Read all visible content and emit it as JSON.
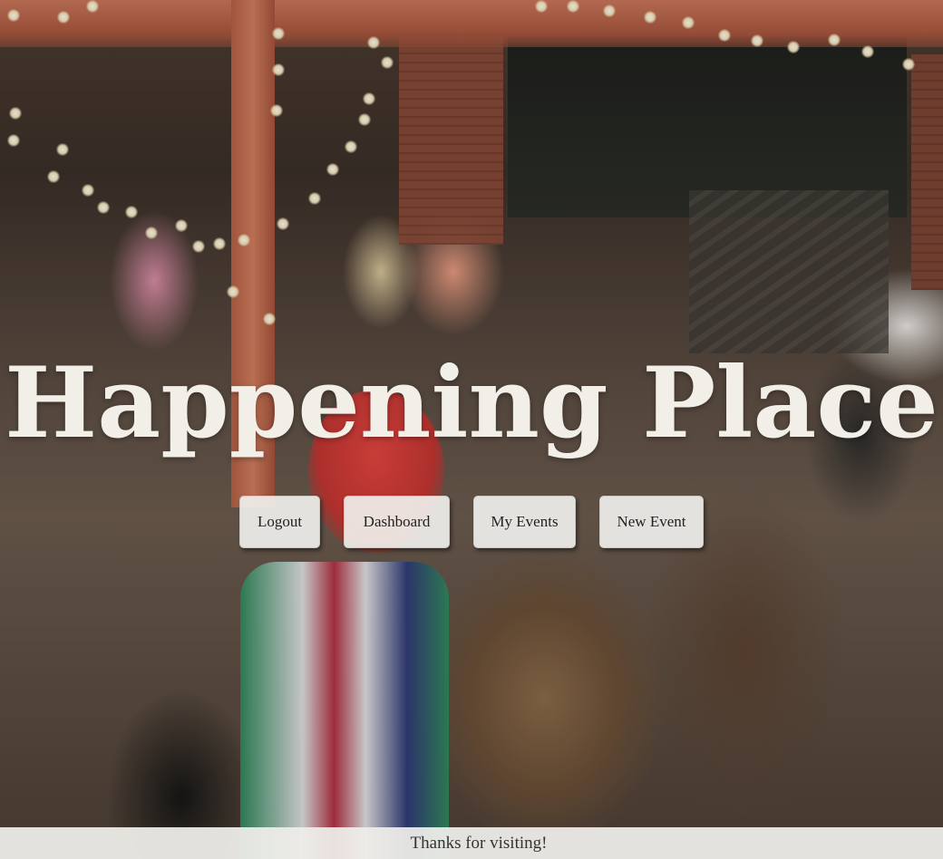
{
  "site": {
    "title": "Happening Place"
  },
  "nav": {
    "logout_label": "Logout",
    "dashboard_label": "Dashboard",
    "my_events_label": "My Events",
    "new_event_label": "New Event"
  },
  "footer": {
    "text": "Thanks for visiting!"
  },
  "background": {
    "image": "blurred-crowd-party-photo"
  }
}
